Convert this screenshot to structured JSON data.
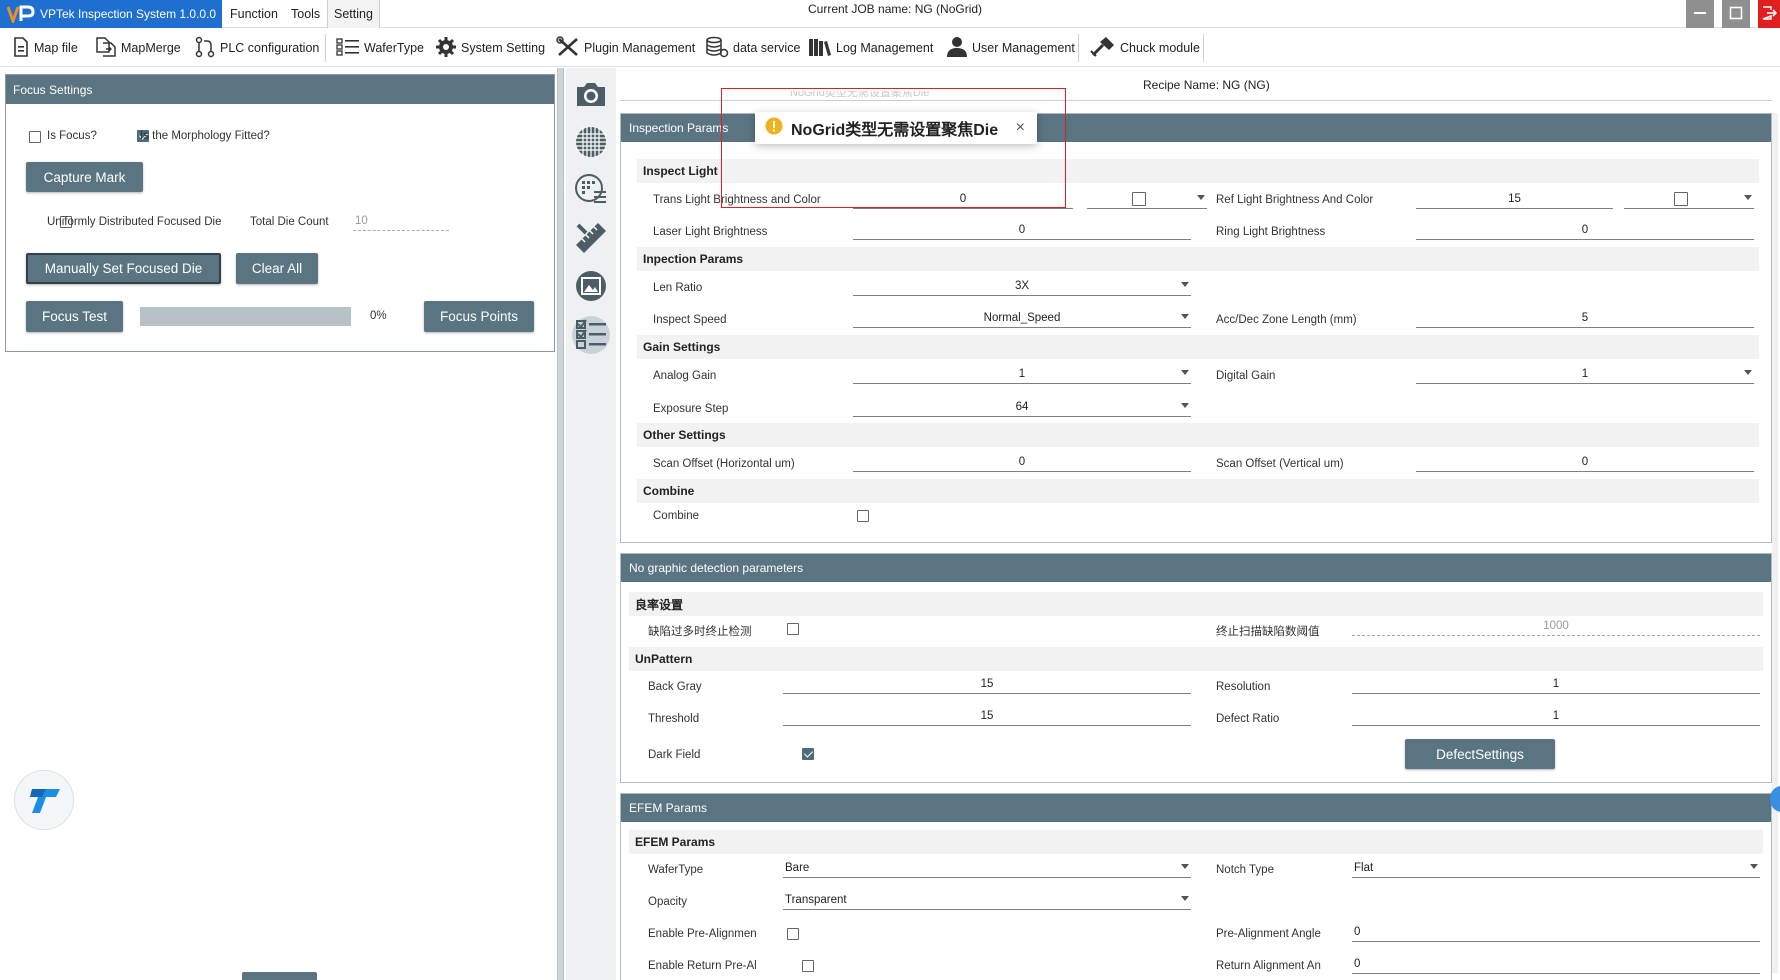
{
  "app": {
    "title": "VPTek Inspection System 1.0.0.0",
    "menu": [
      "Function",
      "Tools",
      "Setting"
    ],
    "current_job": "Current JOB name:  NG (NoGrid)"
  },
  "toolbar": [
    {
      "label": "Map file",
      "icon": "file-icon"
    },
    {
      "label": "MapMerge",
      "icon": "merge-icon"
    },
    {
      "label": "PLC configuration",
      "icon": "plc-icon"
    },
    {
      "label": "WaferType",
      "icon": "list-icon"
    },
    {
      "label": "System Setting",
      "icon": "gear-icon"
    },
    {
      "label": "Plugin Management",
      "icon": "tools-icon"
    },
    {
      "label": "data service",
      "icon": "database-icon"
    },
    {
      "label": "Log Management",
      "icon": "books-icon"
    },
    {
      "label": "User Management",
      "icon": "user-icon"
    },
    {
      "label": "Chuck module",
      "icon": "hammer-icon"
    }
  ],
  "focus": {
    "title": "Focus Settings",
    "is_focus_label": "Is Focus?",
    "is_focus_checked": false,
    "morph_label": "Is the Morphology Fitted?",
    "morph_checked": true,
    "capture_mark": "Capture Mark",
    "uniform_label": "Uniformly Distributed Focused Die",
    "uniform_checked": false,
    "total_die_label": "Total Die Count",
    "total_die_value": "10",
    "manual_set": "Manually Set Focused Die",
    "clear_all": "Clear All",
    "focus_test": "Focus Test",
    "progress_text": "0%",
    "progress": 0,
    "focus_points": "Focus Points"
  },
  "recipe": {
    "name": "Recipe Name: NG (NG)",
    "faded_text": "NoGrid类型无需设置聚焦Die"
  },
  "toast": {
    "message": "NoGrid类型无需设置聚焦Die"
  },
  "inspection": {
    "header": "Inspection Params",
    "inspect_light": "Inspect Light",
    "trans_label": "Trans Light Brightness and Color",
    "trans_value": "0",
    "trans_checked": false,
    "ref_label": "Ref Light Brightness And Color",
    "ref_value": "15",
    "ref_checked": false,
    "laser_label": "Laser Light Brightness",
    "laser_value": "0",
    "ring_label": "Ring Light Brightness",
    "ring_value": "0",
    "inspection_params": "Inpection Params",
    "len_label": "Len Ratio",
    "len_value": "3X",
    "speed_label": "Inspect Speed",
    "speed_value": "Normal_Speed",
    "accdec_label": "Acc/Dec Zone Length (mm)",
    "accdec_value": "5",
    "gain_settings": "Gain Settings",
    "analog_label": "Analog Gain",
    "analog_value": "1",
    "digital_label": "Digital Gain",
    "digital_value": "1",
    "exposure_label": "Exposure Step",
    "exposure_value": "64",
    "other_settings": "Other Settings",
    "scanh_label": "Scan Offset (Horizontal um)",
    "scanh_value": "0",
    "scanv_label": "Scan Offset (Vertical um)",
    "scanv_value": "0",
    "combine_section": "Combine",
    "combine_label": "Combine",
    "combine_checked": false
  },
  "nographic": {
    "header": "No graphic detection parameters",
    "yield_section": "良率设置",
    "stop_label": "缺陷过多时终止检测",
    "stop_checked": false,
    "threshold_label": "终止扫描缺陷数阈值",
    "threshold_value": "1000",
    "unpattern": "UnPattern",
    "backgray_label": "Back Gray",
    "backgray_value": "15",
    "resolution_label": "Resolution",
    "resolution_value": "1",
    "threshold2_label": "Threshold",
    "threshold2_value": "15",
    "defectratio_label": "Defect Ratio",
    "defectratio_value": "1",
    "darkfield_label": "Dark Field",
    "darkfield_checked": true,
    "defect_settings": "DefectSettings"
  },
  "efem": {
    "header": "EFEM Params",
    "section": "EFEM Params",
    "wafertype_label": "WaferType",
    "wafertype_value": "Bare",
    "notch_label": "Notch Type",
    "notch_value": "Flat",
    "opacity_label": "Opacity",
    "opacity_value": "Transparent",
    "prealign_label": "Enable Pre-Alignmen",
    "prealign_checked": false,
    "prealign_angle_label": "Pre-Alignment Angle",
    "prealign_angle_value": "0",
    "return_label": "Enable Return Pre-Al",
    "return_checked": false,
    "return_angle_label": "Return Alignment An",
    "return_angle_value": "0"
  },
  "colors": {
    "brand_blue": "#1e6fd0",
    "panel_header": "#5b7482",
    "close_red": "#e02020",
    "highlight": "#e02020",
    "warning": "#f0b020"
  }
}
